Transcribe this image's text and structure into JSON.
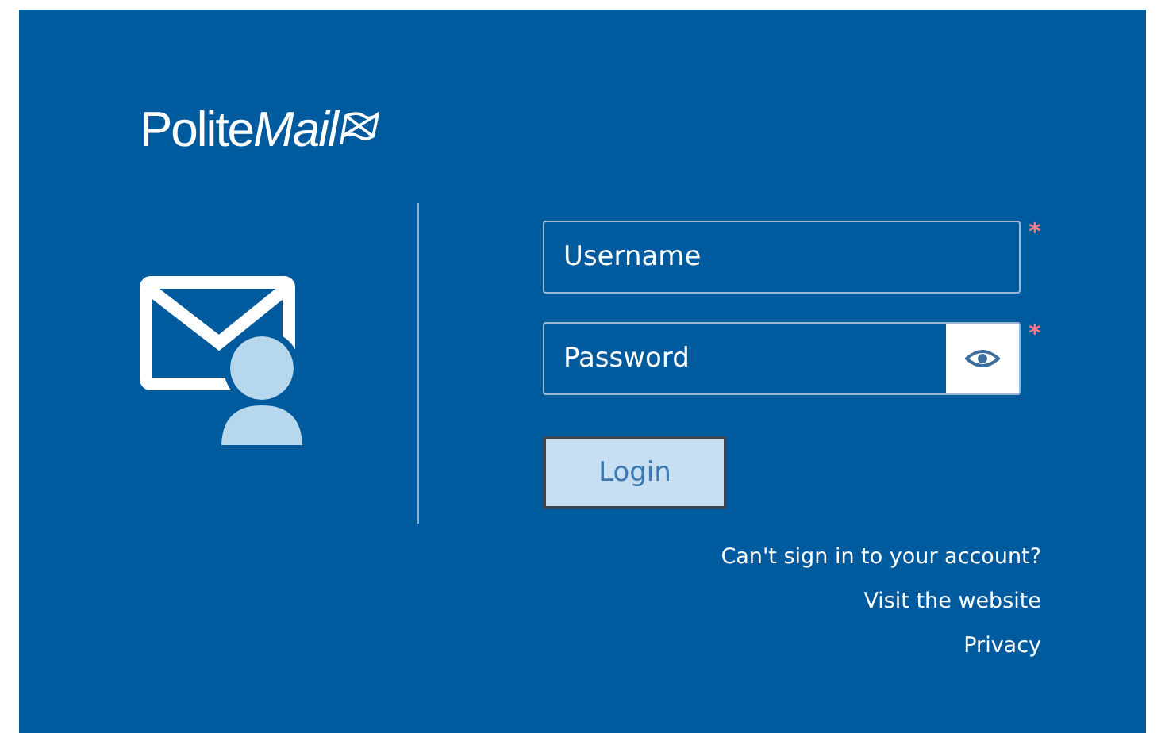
{
  "logo": {
    "plain": "Polite",
    "italic": "Mail"
  },
  "fields": [
    {
      "placeholder": "Username",
      "required_mark": "*",
      "kind": "text"
    },
    {
      "placeholder": "Password",
      "required_mark": "*",
      "kind": "password"
    }
  ],
  "login_button": "Login",
  "links": [
    "Can't sign in to your account?",
    "Visit the website",
    "Privacy"
  ]
}
